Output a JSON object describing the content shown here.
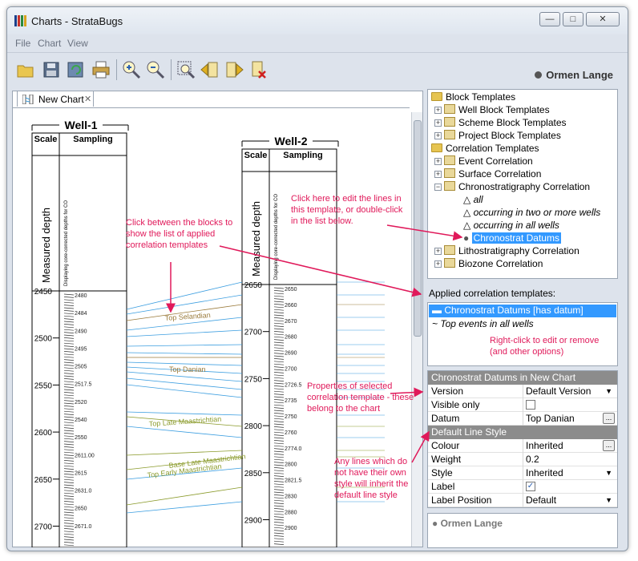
{
  "window": {
    "title": "Charts - StrataBugs"
  },
  "menu": [
    "File",
    "Chart",
    "View"
  ],
  "project": {
    "name": "Ormen Lange"
  },
  "tab": {
    "label": "New Chart"
  },
  "chart": {
    "wells": [
      {
        "name": "Well-1",
        "depth_ticks": [
          "2450",
          "2500",
          "2550",
          "2600",
          "2650",
          "2700"
        ]
      },
      {
        "name": "Well-2",
        "depth_ticks": [
          "2650",
          "2700",
          "2750",
          "2800",
          "2850",
          "2900"
        ]
      }
    ],
    "col_scale": "Scale",
    "col_sampling": "Sampling",
    "measured_depth": "Measured depth",
    "sampling_note": "Displaying core-corrected depths for CO",
    "corr_labels": [
      "Top Selandian",
      "Top Danian",
      "Top Late Maastrichtian",
      "Base Late Maastrichtian",
      "Top Early Maastrichtian"
    ],
    "sample_depths_w1": [
      "2480",
      "2484",
      "2490",
      "2495",
      "2505",
      "2517.5",
      "2520",
      "2540",
      "2550",
      "2611.00",
      "2615",
      "2631.0",
      "2650",
      "2671.0"
    ],
    "sample_depths_w2": [
      "2650",
      "2660",
      "2670",
      "2680",
      "2690",
      "2700",
      "2726.5",
      "2735",
      "2750",
      "2760",
      "2774.0",
      "2800",
      "2821.5",
      "2830",
      "2880",
      "2900"
    ]
  },
  "tree": {
    "items": [
      "Block Templates",
      "Well Block Templates",
      "Scheme Block Templates",
      "Project Block Templates",
      "Correlation Templates",
      "Event Correlation",
      "Surface Correlation",
      "Chronostratigraphy Correlation",
      "all",
      "occurring in two or more wells",
      "occurring in all wells",
      "Chronostrat Datums",
      "Lithostratigraphy Correlation",
      "Biozone Correlation"
    ]
  },
  "applied": {
    "heading": "Applied correlation templates:",
    "items": [
      "Chronostrat Datums [has datum]",
      "Top events in all wells"
    ]
  },
  "props": {
    "header": "Chronostrat Datums in New Chart",
    "rows": [
      {
        "k": "Version",
        "v": "Default Version"
      },
      {
        "k": "Visible only",
        "v": ""
      },
      {
        "k": "Datum",
        "v": "Top Danian"
      }
    ],
    "line_style_header": "Default Line Style",
    "line_rows": [
      {
        "k": "Colour",
        "v": "Inherited"
      },
      {
        "k": "Weight",
        "v": "0.2"
      },
      {
        "k": "Style",
        "v": "Inherited"
      },
      {
        "k": "Label",
        "v": ""
      },
      {
        "k": "Label Position",
        "v": "Default"
      }
    ]
  },
  "bottom_panel": {
    "name": "Ormen Lange"
  },
  "annotations": {
    "click_between": "Click between the blocks to show the list of applied correlation templates",
    "click_here": "Click here to edit  the lines in this  template, or double-click in the list below.",
    "right_click": "Right-click to edit or remove (and other options)",
    "properties": "Properties of selected correlation template - these belong to the chart",
    "any_lines": "Any lines which do not have their own style will inherit the default line style"
  },
  "colors": {
    "accent": "#e0195a",
    "selection": "#3399ff",
    "corr_line": "#3c9ee0",
    "olive": "#8a9a2a",
    "brown": "#9a7a3a"
  }
}
